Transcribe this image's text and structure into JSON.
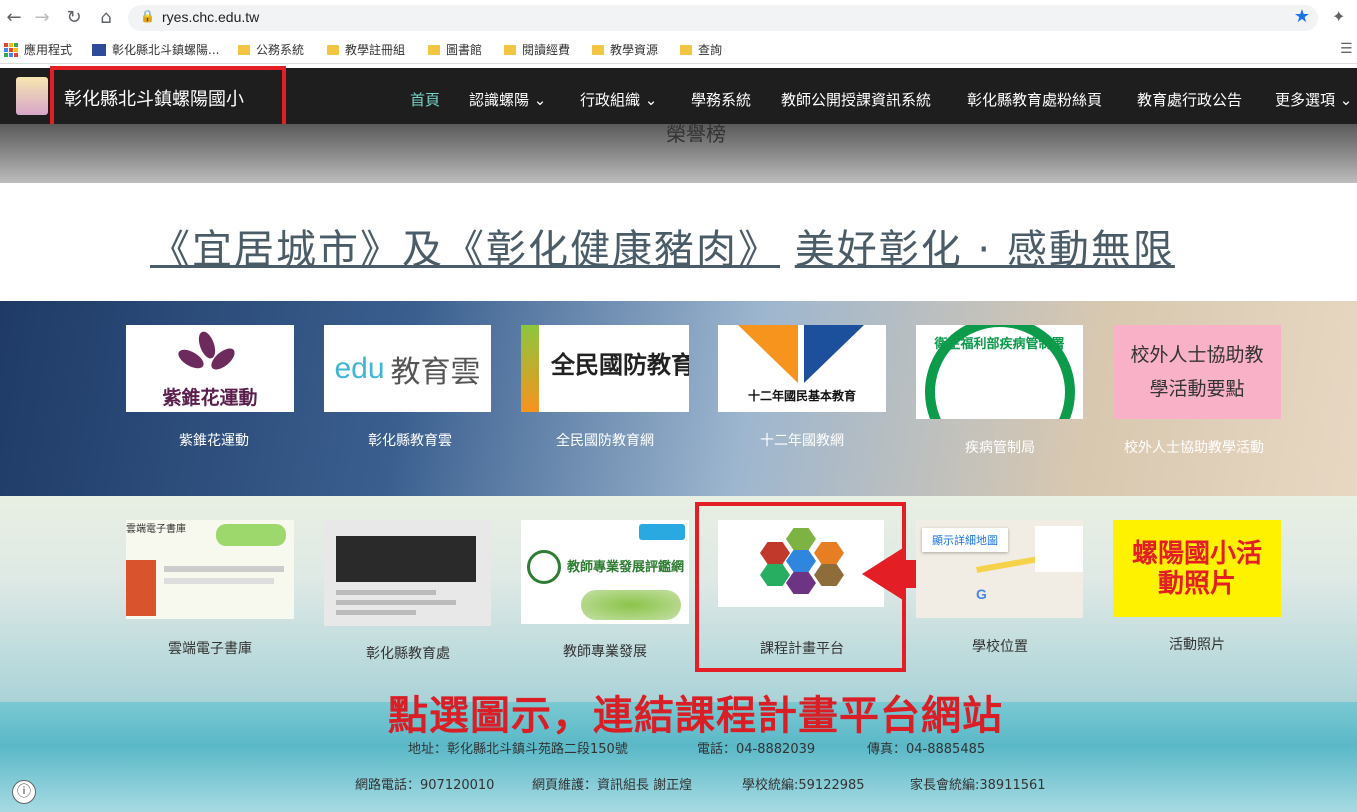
{
  "browser": {
    "url": "ryes.chc.edu.tw",
    "bookmarks": [
      "應用程式",
      "彰化縣北斗鎮螺陽...",
      "公務系統",
      "教學註冊組",
      "圖書館",
      "閱讀經費",
      "教學資源",
      "查詢"
    ]
  },
  "site": {
    "title": "彰化縣北斗鎮螺陽國小",
    "nav": [
      "首頁",
      "認識螺陽",
      "行政組織",
      "學務系統",
      "教師公開授課資訊系統",
      "彰化縣教育處粉絲頁",
      "教育處行政公告",
      "更多選項"
    ],
    "hero_partial_text": "榮譽榜",
    "slogan_part1": "《宜居城市》及《彰化健康豬肉》",
    "slogan_part2": "美好彰化 · 感動無限"
  },
  "links_row1": [
    {
      "tile": "紫錐花運動",
      "caption": "紫錐花運動"
    },
    {
      "tile": "教育雲",
      "caption": "彰化縣教育雲"
    },
    {
      "tile": "全民國防教育",
      "caption": "全民國防教育網"
    },
    {
      "tile": "十二年國民基本教育",
      "caption": "十二年國教網"
    },
    {
      "tile": "衛生福利部疾病管制署",
      "caption": "疾病管制局"
    },
    {
      "tile": "校外人士協助教學活動要點",
      "caption": "校外人士協助教學活動"
    }
  ],
  "links_row2": [
    {
      "tile": "雲端電子書庫",
      "caption": "雲端電子書庫"
    },
    {
      "tile": "",
      "caption": "彰化縣教育處"
    },
    {
      "tile": "教師專業發展評鑑網",
      "caption": "教師專業發展"
    },
    {
      "tile": "",
      "caption": "課程計畫平台"
    },
    {
      "tile": "顯示詳細地圖",
      "caption": "學校位置"
    },
    {
      "tile": "螺陽國小活動照片",
      "caption": "活動照片"
    }
  ],
  "callout": "點選圖示，連結課程計畫平台網站",
  "footer": {
    "address": "地址：彰化縣北斗鎮斗苑路二段150號",
    "phone": "電話：04-8882039",
    "fax": "傳真：04-8885485",
    "net_phone": "網路電話：907120010",
    "maintainer": "網頁維護：資訊組長 謝正煌",
    "school_id": "學校統編:59122985",
    "parent_id": "家長會統編:38911561"
  },
  "colors": {
    "highlight": "#e31e24",
    "nav_active": "#7ad3c8",
    "header_bg": "#1e1e1e"
  }
}
